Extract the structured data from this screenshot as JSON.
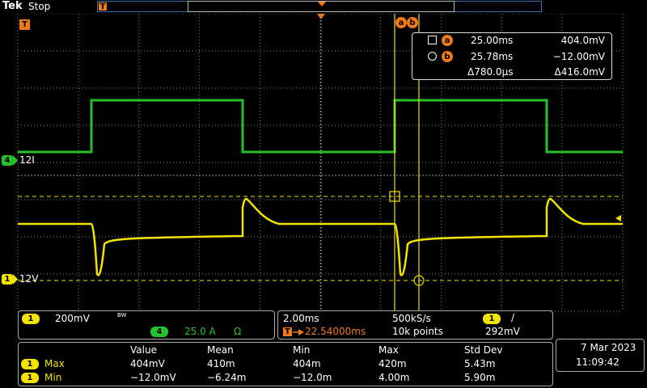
{
  "header": {
    "brand": "Tek",
    "acquisition_state": "Stop",
    "trigger_marker": "T"
  },
  "channels": {
    "ch1": {
      "number": "1",
      "ref_label": "12V",
      "scale": "200mV",
      "bw_marker": "BW",
      "color": "#f2e300"
    },
    "ch4": {
      "number": "4",
      "ref_label": "12I",
      "scale": "25.0 A",
      "unit_icon": "Ω",
      "color": "#26c22b"
    }
  },
  "cursors": {
    "a": {
      "icon": "square",
      "label": "a",
      "time": "25.00ms",
      "value": "404.0mV"
    },
    "b": {
      "icon": "circle",
      "label": "b",
      "time": "25.78ms",
      "value": "−12.00mV"
    },
    "delta_time": "Δ780.0µs",
    "delta_value": "Δ416.0mV",
    "marker_labels": [
      "a",
      "b"
    ]
  },
  "timebase": {
    "scale": "2.00ms",
    "sample_rate": "500kS/s",
    "trigger_position": "22.54000ms",
    "record_length": "10k points",
    "trigger_channel": "1",
    "trigger_slope": "/",
    "trigger_level": "292mV"
  },
  "measurements": {
    "headers": [
      "Value",
      "Mean",
      "Min",
      "Max",
      "Std Dev"
    ],
    "rows": [
      {
        "channel": "1",
        "name": "Max",
        "cells": [
          "404mV",
          "410m",
          "404m",
          "420m",
          "5.43m"
        ]
      },
      {
        "channel": "1",
        "name": "Min",
        "cells": [
          "−12.0mV",
          "−6.24m",
          "−12.0m",
          "4.00m",
          "5.90m"
        ]
      }
    ]
  },
  "datetime": {
    "date": "7 Mar  2023",
    "time": "11:09:42"
  },
  "colors": {
    "grid": "#7a7a7a",
    "ch1": "#f2e300",
    "ch4": "#26c22b",
    "cursor": "#f2e300",
    "trigger": "#f07a1a"
  }
}
